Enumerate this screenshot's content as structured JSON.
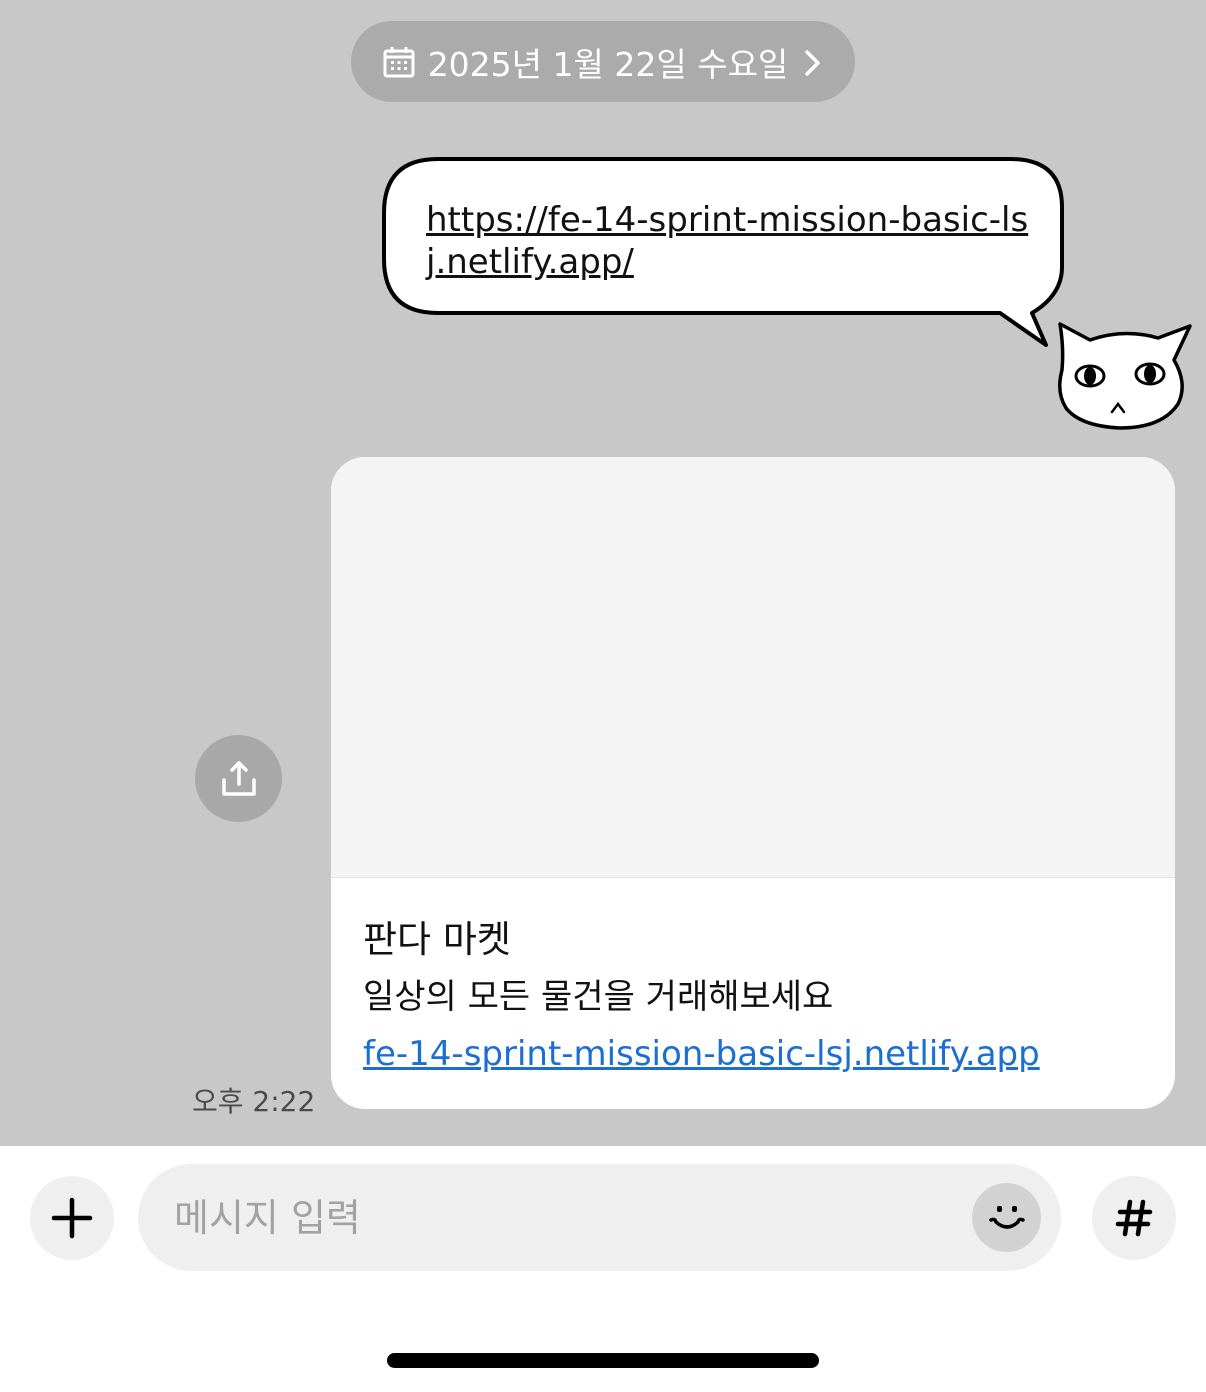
{
  "date_header": {
    "label": "2025년 1월 22일 수요일",
    "icon": "calendar-icon",
    "trailing_icon": "chevron-right-icon"
  },
  "sent_sticker": {
    "bubble_text": "https://fe-14-sprint-mission-basic-lsj.netlify.app/",
    "avatar": "cat-sticker"
  },
  "link_preview": {
    "title": "판다 마켓",
    "description": "일상의 모든 물건을 거래해보세요",
    "url_label": "fe-14-sprint-mission-basic-lsj.netlify.app",
    "timestamp": "오후 2:22",
    "share_icon": "share-icon"
  },
  "composer": {
    "placeholder": "메시지 입력",
    "plus_icon": "plus-icon",
    "emoji_icon": "emoji-icon",
    "hashtag_icon": "hashtag-icon"
  },
  "colors": {
    "chat_background": "#c8c8c8",
    "link_color": "#1c6fd1",
    "pill_background": "#ababab"
  }
}
